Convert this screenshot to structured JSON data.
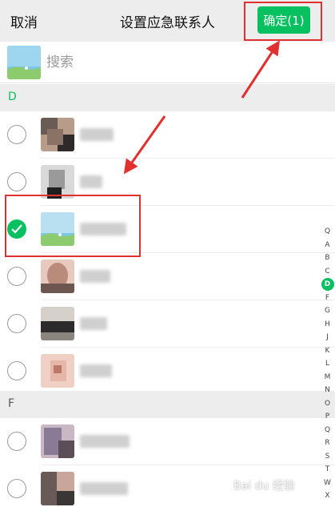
{
  "header": {
    "cancel_label": "取消",
    "title": "设置应急联系人",
    "confirm_label": "确定(1)"
  },
  "search": {
    "placeholder": "搜索"
  },
  "sections": {
    "d_label": "D",
    "f_label": "F"
  },
  "contacts": [
    {
      "section": "D",
      "selected": false,
      "avatar_colors": [
        "#6b5b55",
        "#b79c8a",
        "#2f2a2a"
      ]
    },
    {
      "section": "D",
      "selected": false,
      "avatar_colors": [
        "#9a9a9a",
        "#d9d9d9",
        "#1f1f1f"
      ]
    },
    {
      "section": "D",
      "selected": true,
      "avatar_colors": [
        "#7cc6e8",
        "#b8e0f0",
        "#8ccc6e"
      ]
    },
    {
      "section": "D",
      "selected": false,
      "avatar_colors": [
        "#b98b7b",
        "#e7c9bd",
        "#6d5550"
      ]
    },
    {
      "section": "D",
      "selected": false,
      "avatar_colors": [
        "#d6d0cb",
        "#2b2b2b",
        "#8b857f"
      ]
    },
    {
      "section": "D",
      "selected": false,
      "avatar_colors": [
        "#e6b7a9",
        "#f0cfc4",
        "#b9786a"
      ]
    },
    {
      "section": "F",
      "selected": false,
      "avatar_colors": [
        "#8a7a96",
        "#c9b7c4",
        "#5b4e57"
      ]
    },
    {
      "section": "F",
      "selected": false,
      "avatar_colors": [
        "#6a5a57",
        "#c8a69a",
        "#3a3636"
      ]
    }
  ],
  "index_letters": [
    "Q",
    "A",
    "B",
    "C",
    "D",
    "F",
    "G",
    "H",
    "J",
    "K",
    "L",
    "M",
    "N",
    "O",
    "P",
    "Q",
    "R",
    "S",
    "T",
    "W",
    "X"
  ],
  "active_index": "D",
  "colors": {
    "accent": "#07c160",
    "annotation": "#e03030"
  },
  "watermark": "Bai du 经验"
}
